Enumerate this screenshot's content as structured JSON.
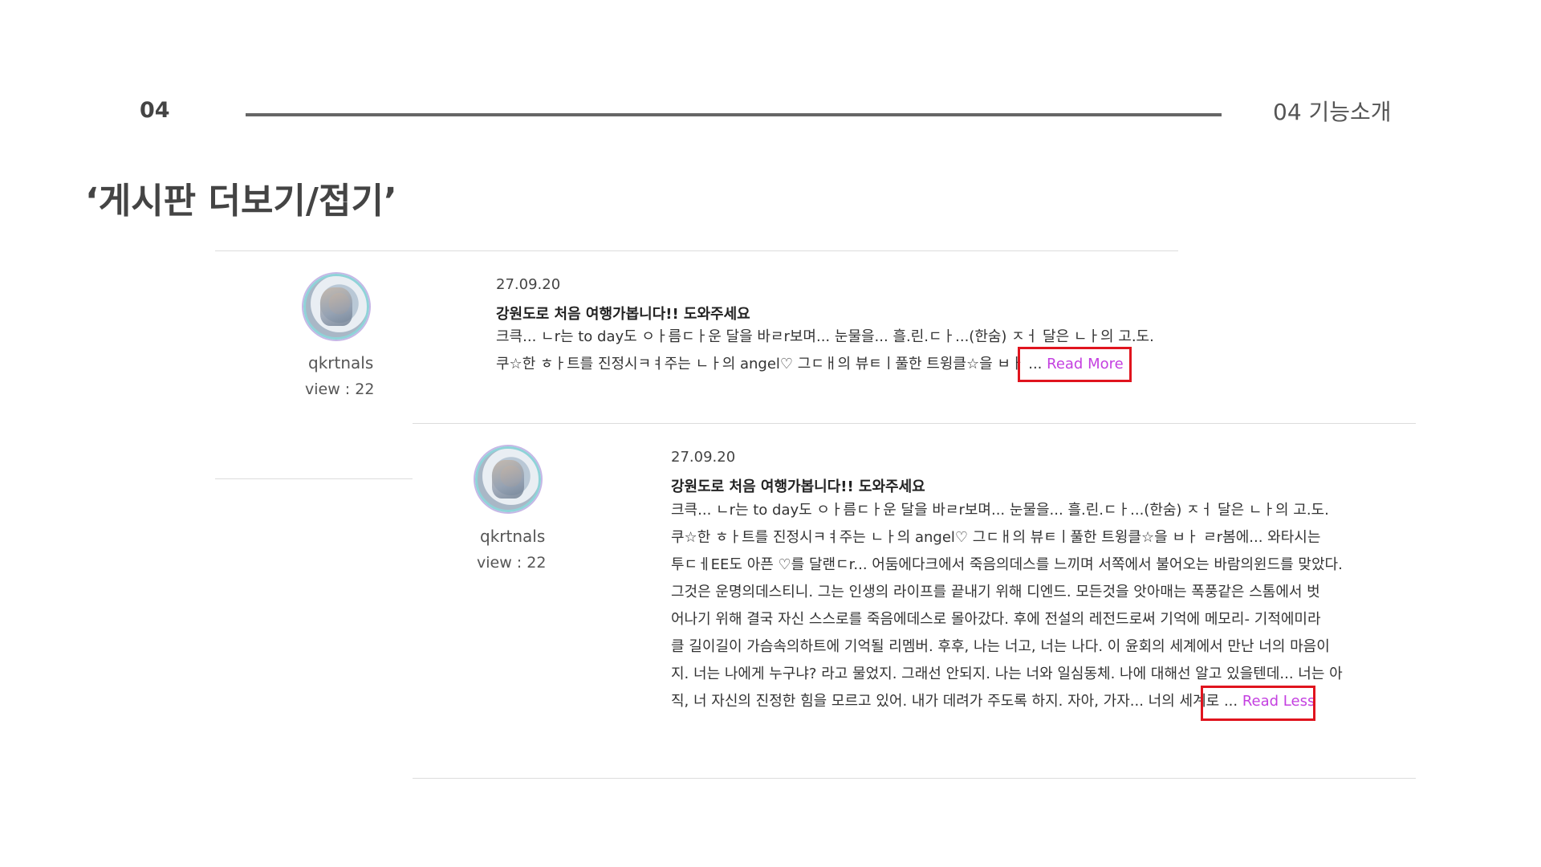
{
  "header": {
    "slide_number": "04",
    "section_label": "04  기능소개"
  },
  "slide_title": "‘게시판 더보기/접기’",
  "colors": {
    "link": "#c440e0",
    "highlight": "#e0141e",
    "avatar_border": "#8fd3d8"
  },
  "posts": [
    {
      "username": "qkrtnals",
      "views": "view : 22",
      "date": "27.09.20",
      "title": "강원도로 처음 여행가봅니다!! 도와주세요",
      "body_lines": [
        "크큭... ㄴr는 to day도 ㅇㅏ름ㄷㅏ운 달을 바ㄹr보며... 눈물을... 흘.린.ㄷㅏ...(한숨) ㅈㅓ 달은 ㄴㅏ의 고.도.",
        "쿠☆한 ㅎㅏ트를 진정시ㅋㅕ주는 ㄴㅏ의 angel♡ 그ㄷㅐ의 뷰ㅌㅣ풀한 트윙클☆을 ㅂㅏ"
      ],
      "ellipsis": "...",
      "toggle_label": "Read More"
    },
    {
      "username": "qkrtnals",
      "views": "view : 22",
      "date": "27.09.20",
      "title": "강원도로 처음 여행가봅니다!! 도와주세요",
      "body_lines": [
        "크큭... ㄴr는 to day도 ㅇㅏ름ㄷㅏ운 달을 바ㄹr보며... 눈물을... 흘.린.ㄷㅏ...(한숨) ㅈㅓ 달은 ㄴㅏ의 고.도.",
        "쿠☆한 ㅎㅏ트를 진정시ㅋㅕ주는 ㄴㅏ의 angel♡ 그ㄷㅐ의 뷰ㅌㅣ풀한 트윙클☆을 ㅂㅏ ㄹr봄에... 와타시는",
        "투ㄷㅔEE도 아픈 ♡를 달랜ㄷr... 어둠에다크에서 죽음의데스를 느끼며 서쪽에서 불어오는 바람의윈드를 맞았다.",
        "그것은 운명의데스티니. 그는 인생의 라이프를 끝내기 위해 디엔드. 모든것을 앗아매는 폭풍같은 스톰에서 벗",
        "어나기 위해 결국 자신 스스로를 죽음에데스로 몰아갔다. 후에 전설의 레전드로써 기억에 메모리- 기적에미라",
        "클 길이길이 가슴속의하트에 기억될 리멤버. 후후, 나는 너고, 너는 나다. 이 윤회의 세계에서 만난 너의 마음이",
        "지. 너는 나에게 누구냐? 라고 물었지. 그래선 안되지. 나는 너와 일심동체. 나에 대해선 알고 있을텐데... 너는 아",
        "직, 너 자신의 진정한 힘을 모르고 있어. 내가 데려가 주도록 하지. 자아, 가자... 너의 세계로"
      ],
      "ellipsis": "...",
      "toggle_label": "Read Less"
    }
  ]
}
